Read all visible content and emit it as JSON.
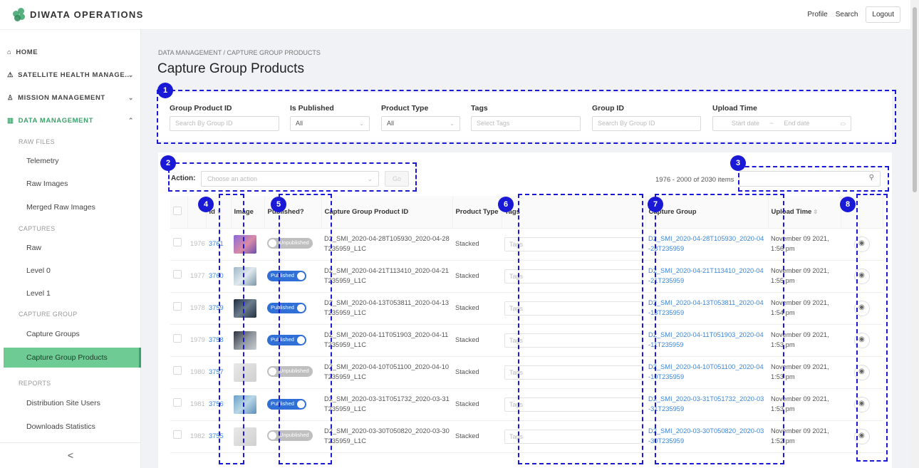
{
  "app": {
    "title": "DIWATA OPERATIONS"
  },
  "topnav": {
    "profile": "Profile",
    "search": "Search",
    "logout": "Logout"
  },
  "sidebar": {
    "home": "HOME",
    "satellite": "SATELLITE HEALTH MANAGE...",
    "mission": "MISSION MANAGEMENT",
    "data": "DATA MANAGEMENT",
    "raw_files": "RAW FILES",
    "telemetry": "Telemetry",
    "raw_images": "Raw Images",
    "merged_raw_images": "Merged Raw Images",
    "captures": "CAPTURES",
    "raw": "Raw",
    "level0": "Level 0",
    "level1": "Level 1",
    "capture_group": "CAPTURE GROUP",
    "capture_groups": "Capture Groups",
    "capture_group_products": "Capture Group Products",
    "reports": "REPORTS",
    "distribution_users": "Distribution Site Users",
    "downloads_stats": "Downloads Statistics",
    "collapse": "<"
  },
  "breadcrumb": "DATA MANAGEMENT  /  CAPTURE GROUP PRODUCTS",
  "page_title": "Capture Group Products",
  "filters": {
    "group_product_id": {
      "label": "Group Product ID",
      "placeholder": "Search By Group ID"
    },
    "is_published": {
      "label": "Is Published",
      "value": "All"
    },
    "product_type": {
      "label": "Product Type",
      "value": "All"
    },
    "tags": {
      "label": "Tags",
      "placeholder": "Select Tags"
    },
    "group_id": {
      "label": "Group ID",
      "placeholder": "Search By Group ID"
    },
    "upload_time": {
      "label": "Upload Time",
      "start": "Start date",
      "end": "End date",
      "sep": "~"
    }
  },
  "actions": {
    "label": "Action:",
    "placeholder": "Choose an action",
    "go": "Go"
  },
  "item_count": "1976 - 2000 of 2030 items",
  "table": {
    "headers": {
      "id": "Id",
      "image": "Image",
      "published": "Published?",
      "product_id": "Capture Group Product ID",
      "product_type": "Product Type",
      "tags": "Tags",
      "capture_group": "Capture Group",
      "upload_time": "Upload Time"
    },
    "tag_placeholder": "Tags",
    "rows": [
      {
        "idx": "1976",
        "id": "3761",
        "published": "Unpublished",
        "product_id": "D2_SMI_2020-04-28T105930_2020-04-28T235959_L1C",
        "type": "Stacked",
        "group": "D2_SMI_2020-04-28T105930_2020-04-28T235959",
        "time": "November 09 2021, 1:56 pm"
      },
      {
        "idx": "1977",
        "id": "3760",
        "published": "Published",
        "product_id": "D2_SMI_2020-04-21T113410_2020-04-21T235959_L1C",
        "type": "Stacked",
        "group": "D2_SMI_2020-04-21T113410_2020-04-21T235959",
        "time": "November 09 2021, 1:55 pm"
      },
      {
        "idx": "1978",
        "id": "3759",
        "published": "Published",
        "product_id": "D2_SMI_2020-04-13T053811_2020-04-13T235959_L1C",
        "type": "Stacked",
        "group": "D2_SMI_2020-04-13T053811_2020-04-13T235959",
        "time": "November 09 2021, 1:54 pm"
      },
      {
        "idx": "1979",
        "id": "3758",
        "published": "Published",
        "product_id": "D2_SMI_2020-04-11T051903_2020-04-11T235959_L1C",
        "type": "Stacked",
        "group": "D2_SMI_2020-04-11T051903_2020-04-11T235959",
        "time": "November 09 2021, 1:53 pm"
      },
      {
        "idx": "1980",
        "id": "3757",
        "published": "Unpublished",
        "product_id": "D2_SMI_2020-04-10T051100_2020-04-10T235959_L1C",
        "type": "Stacked",
        "group": "D2_SMI_2020-04-10T051100_2020-04-10T235959",
        "time": "November 09 2021, 1:53 pm"
      },
      {
        "idx": "1981",
        "id": "3756",
        "published": "Published",
        "product_id": "D2_SMI_2020-03-31T051732_2020-03-31T235959_L1C",
        "type": "Stacked",
        "group": "D2_SMI_2020-03-31T051732_2020-03-31T235959",
        "time": "November 09 2021, 1:53 pm"
      },
      {
        "idx": "1982",
        "id": "3755",
        "published": "Unpublished",
        "product_id": "D2_SMI_2020-03-30T050820_2020-03-30T235959_L1C",
        "type": "Stacked",
        "group": "D2_SMI_2020-03-30T050820_2020-03-30T235959",
        "time": "November 09 2021, 1:52 pm"
      }
    ]
  },
  "annotations": [
    "1",
    "2",
    "3",
    "4",
    "5",
    "6",
    "7",
    "8"
  ],
  "colors": {
    "accent": "#3aa26a",
    "annotation": "#1a1ad6",
    "link": "#3c86d8",
    "toggle_on": "#2f6fd6"
  }
}
